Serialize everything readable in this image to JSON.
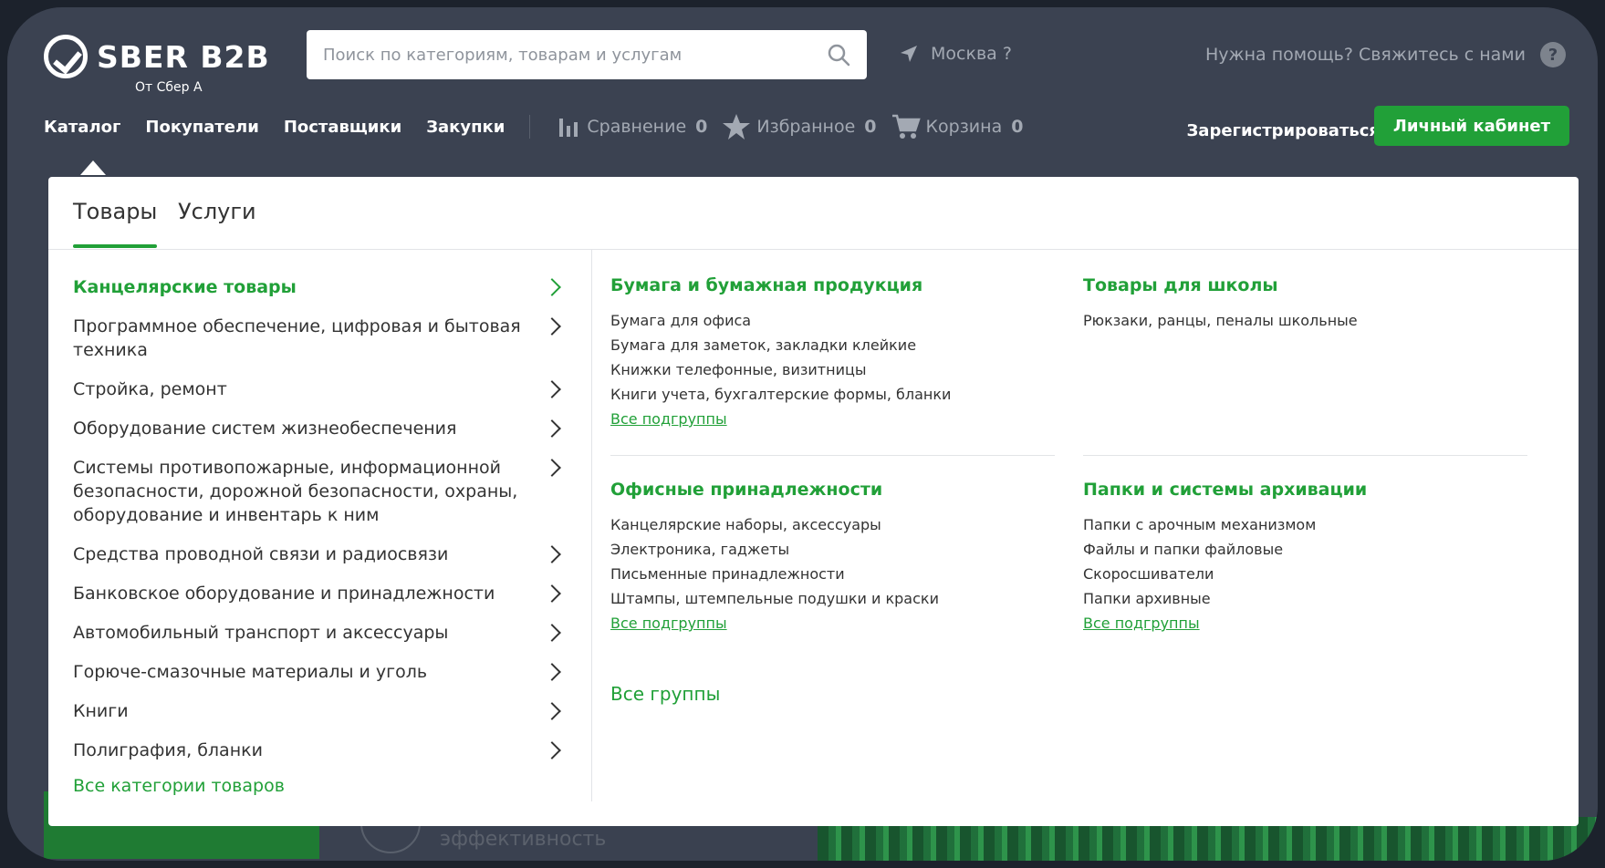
{
  "header": {
    "logo_text": "SBER B2B",
    "logo_sub": "От Сбер А",
    "search_placeholder": "Поиск по категориям, товарам и услугам",
    "city": "Москва ?",
    "help_text": "Нужна помощь? Свяжитесь с нами",
    "help_icon_text": "?"
  },
  "nav": {
    "catalog": "Каталог",
    "buyers": "Покупатели",
    "suppliers": "Поставщики",
    "purchases": "Закупки",
    "compare_label": "Сравнение",
    "compare_count": "0",
    "favorites_label": "Избранное",
    "favorites_count": "0",
    "cart_label": "Корзина",
    "cart_count": "0",
    "register": "Зарегистрироваться",
    "cabinet": "Личный кабинет"
  },
  "background": {
    "button_label": "Личный кабинет",
    "hero_text": "эффективность"
  },
  "catalog": {
    "tabs": [
      "Товары",
      "Услуги"
    ],
    "categories": [
      "Канцелярские товары",
      "Программное обеспечение, цифровая и бытовая техника",
      "Стройка, ремонт",
      "Оборудование систем жизнеобеспечения",
      "Системы противопожарные, информационной безопасности, дорожной безопасности, охраны, оборудование и инвентарь к ним",
      "Средства проводной связи и радиосвязи",
      "Банковское оборудование и принадлежности",
      "Автомобильный транспорт и аксессуары",
      "Горюче-смазочные материалы и уголь",
      "Книги",
      "Полиграфия, бланки"
    ],
    "all_categories": "Все категории товаров",
    "groups": [
      {
        "title": "Бумага и бумажная продукция",
        "items": [
          "Бумага для офиса",
          "Бумага для заметок, закладки клейкие",
          "Книжки телефонные, визитницы",
          "Книги учета, бухгалтерские формы, бланки"
        ],
        "all": "Все подгруппы"
      },
      {
        "title": "Товары для школы",
        "items": [
          "Рюкзаки, ранцы, пеналы школьные"
        ]
      },
      {
        "title": "Офисные принадлежности",
        "items": [
          "Канцелярские наборы, аксессуары",
          "Электроника, гаджеты",
          "Письменные принадлежности",
          "Штампы, штемпельные подушки и краски"
        ],
        "all": "Все подгруппы"
      },
      {
        "title": "Папки и системы архивации",
        "items": [
          "Папки с арочным механизмом",
          "Файлы и папки файловые",
          "Скоросшиватели",
          "Папки архивные"
        ],
        "all": "Все подгруппы"
      }
    ],
    "all_groups": "Все группы"
  },
  "colors": {
    "accent": "#21a038",
    "header_bg": "#3b4251"
  }
}
